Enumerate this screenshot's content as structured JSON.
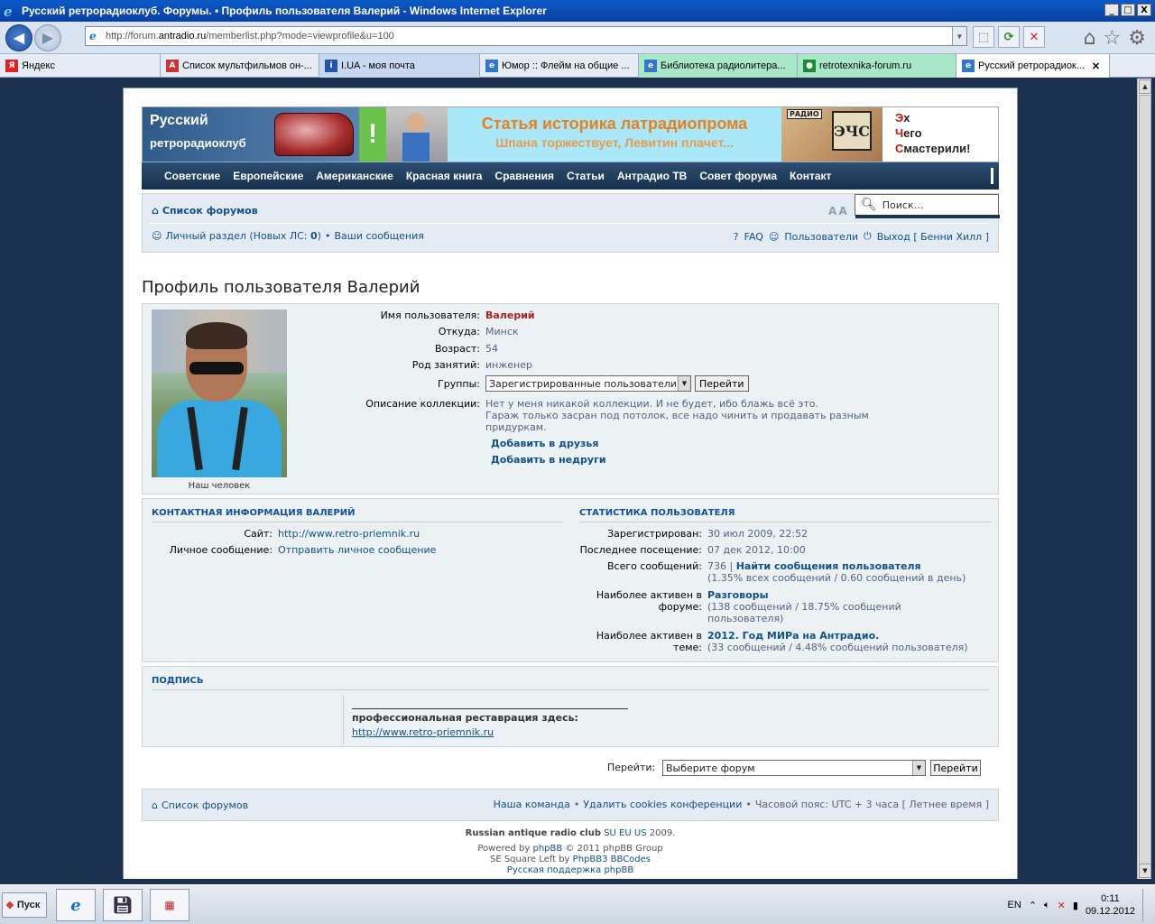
{
  "window": {
    "title": "Русский ретрорадиоклуб. Форумы. • Профиль пользователя Валерий - Windows Internet Explorer",
    "min": "_",
    "max": "□",
    "close": "X"
  },
  "browser": {
    "address_prefix": "http://forum.",
    "address_domain": "antradio.ru",
    "address_path": "/memberlist.php?mode=viewprofile&u=100",
    "tabs": [
      {
        "label": "Яндекс",
        "icon": "Я",
        "color": "#d22"
      },
      {
        "label": "Список мультфильмов он-...",
        "icon": "A",
        "color": "#c33"
      },
      {
        "label": "I.UA - моя почта",
        "icon": "i",
        "color": "#2255aa"
      },
      {
        "label": "Юмор :: Флейм на общие ...",
        "icon": "e",
        "color": "#3377cc"
      },
      {
        "label": "Библиотека радиолитера...",
        "icon": "e",
        "color": "#3377cc"
      },
      {
        "label": "retrotexnika-forum.ru",
        "icon": "●",
        "color": "#1a8a3a"
      },
      {
        "label": "Русский ретрорадиок...",
        "icon": "e",
        "color": "#3377cc"
      }
    ],
    "active_tab_close": "✕"
  },
  "banner": {
    "club_line1": "Русский",
    "club_line2": "ретрорадиоклуб",
    "exclaim": "!",
    "headline1": "Статья историка латрадиопрома",
    "headline2": "Шпана торжествует, Левитин плачет...",
    "radio_label": "РАДИО",
    "ezs_logo": "ЭЧС",
    "eh1": "Эх",
    "eh2": "Чего",
    "eh3": "Смастерили!",
    "eh1_first": "Э",
    "eh1_rest": "х",
    "eh2_first": "Ч",
    "eh2_rest": "его",
    "eh3_first": "С",
    "eh3_rest": "мастерили!"
  },
  "menu": [
    "Советские",
    "Европейские",
    "Американские",
    "Красная книга",
    "Сравнения",
    "Статьи",
    "Антрадио ТВ",
    "Совет форума",
    "Контакт"
  ],
  "nav": {
    "forum_list": "Список форумов",
    "font_size": "A A",
    "search_placeholder": "Поиск...",
    "personal": "Личный раздел (Новых ЛС:",
    "new_pm": "0",
    "personal_close": ")",
    "bullet": "•",
    "your_posts": "Ваши сообщения",
    "faq": "FAQ",
    "users": "Пользователи",
    "logout": "Выход [ Бенни Хилл ]"
  },
  "profile": {
    "title": "Профиль пользователя Валерий",
    "avatar_caption": "Наш человек",
    "fields": {
      "username_label": "Имя пользователя:",
      "username": "Валерий",
      "from_label": "Откуда:",
      "from": "Минск",
      "age_label": "Возраст:",
      "age": "54",
      "occupation_label": "Род занятий:",
      "occupation": "инженер",
      "groups_label": "Группы:",
      "group_selected": "Зарегистрированные пользователи",
      "go": "Перейти",
      "collection_label": "Описание коллекции:",
      "collection_line1": "Нет у меня никакой коллекции. И не будет, ибо блажь всё это.",
      "collection_line2": "Гараж только засран под потолок, все надо чинить и продавать разным",
      "collection_line3": "придуркам."
    },
    "add_friend": "Добавить в друзья",
    "add_foe": "Добавить в недруги"
  },
  "contact": {
    "header": "КОНТАКТНАЯ ИНФОРМАЦИЯ ВАЛЕРИЙ",
    "site_label": "Сайт:",
    "site": "http://www.retro-priemnik.ru",
    "pm_label": "Личное сообщение:",
    "pm": "Отправить личное сообщение"
  },
  "stats": {
    "header": "СТАТИСТИКА ПОЛЬЗОВАТЕЛЯ",
    "registered_label": "Зарегистрирован:",
    "registered": "30 июл 2009, 22:52",
    "last_visit_label": "Последнее посещение:",
    "last_visit": "07 дек 2012, 10:00",
    "total_label": "Всего сообщений:",
    "total": "736",
    "total_sep": "|",
    "find_posts": "Найти сообщения пользователя",
    "total_detail": "(1.35% всех сообщений / 0.60 сообщений в день)",
    "active_forum_label1": "Наиболее активен в",
    "active_forum_label2": "форуме:",
    "active_forum": "Разговоры",
    "active_forum_detail1": "(138 сообщений / 18.75% сообщений",
    "active_forum_detail2": "пользователя)",
    "active_topic_label1": "Наиболее активен в",
    "active_topic_label2": "теме:",
    "active_topic": "2012. Год МИРа на Антрадио.",
    "active_topic_detail": "(33 сообщений / 4.48% сообщений пользователя)"
  },
  "signature": {
    "header": "ПОДПИСЬ",
    "line": "професcиональная реставрация здесь:",
    "link": "http://www.retro-priemnik.ru"
  },
  "jump": {
    "label": "Перейти:",
    "selected": "Выберите форум",
    "go": "Перейти"
  },
  "footer": {
    "forum_list": "Список форумов",
    "team": "Наша команда",
    "bullet": "•",
    "delete_cookies": "Удалить cookies конференции",
    "timezone": "Часовой пояс: UTC + 3 часа [ Летнее время ]",
    "club": "Russian antique radio club",
    "su": "SU",
    "eu": "EU",
    "us": "US",
    "year": "2009.",
    "powered_pre": "Powered by",
    "phpbb": "phpBB",
    "powered_post": "© 2011 phpBB Group",
    "se_pre": "SE Square Left by",
    "se_link": "PhpBB3 BBCodes",
    "ru_support": "Русская поддержка phpBB"
  },
  "taskbar": {
    "start": "Пуск",
    "lang": "EN",
    "time": "0:11",
    "date": "09.12.2012"
  }
}
